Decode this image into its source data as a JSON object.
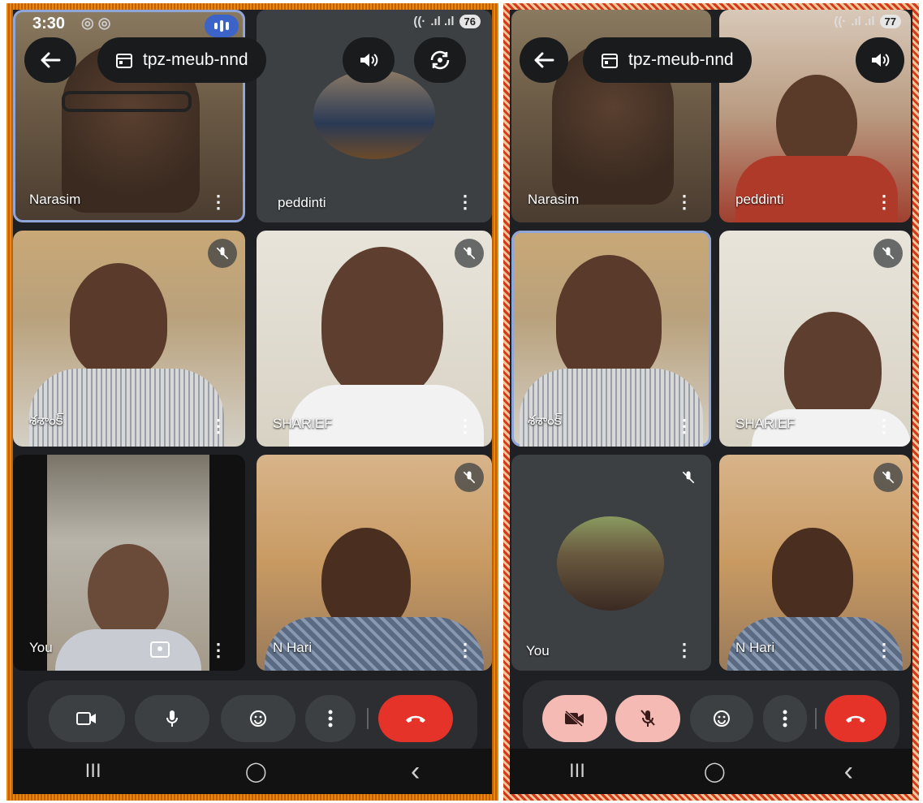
{
  "left_screen": {
    "status": {
      "time": "3:30",
      "battery": "76"
    },
    "meeting_code": "tpz-meub-nnd",
    "tiles": [
      {
        "name": "Narasim"
      },
      {
        "name": "peddinti"
      },
      {
        "name": "శశాంక్"
      },
      {
        "name": "SHARIEF"
      },
      {
        "name": "You"
      },
      {
        "name": "N Hari"
      }
    ]
  },
  "right_screen": {
    "status": {
      "battery": "77"
    },
    "meeting_code": "tpz-meub-nnd",
    "tiles": [
      {
        "name": "Narasim"
      },
      {
        "name": "peddinti"
      },
      {
        "name": "శశాంక్"
      },
      {
        "name": "SHARIEF"
      },
      {
        "name": "You"
      },
      {
        "name": "N Hari"
      }
    ]
  },
  "nav": {
    "recents": "III",
    "home": "◯",
    "back": "‹"
  },
  "icons": {
    "back": "arrow-left-icon",
    "calendar": "calendar-icon",
    "speaker": "speaker-icon",
    "switch_camera": "switch-camera-icon",
    "mic_off": "mic-off-icon",
    "camera": "camera-icon",
    "mic": "mic-icon",
    "emoji": "emoji-icon",
    "more": "more-vert-icon",
    "end_call": "end-call-icon"
  },
  "colors": {
    "end_call": "#e5332a",
    "control_off": "#f5bab4",
    "active_tile_border": "#8fa6d9"
  }
}
